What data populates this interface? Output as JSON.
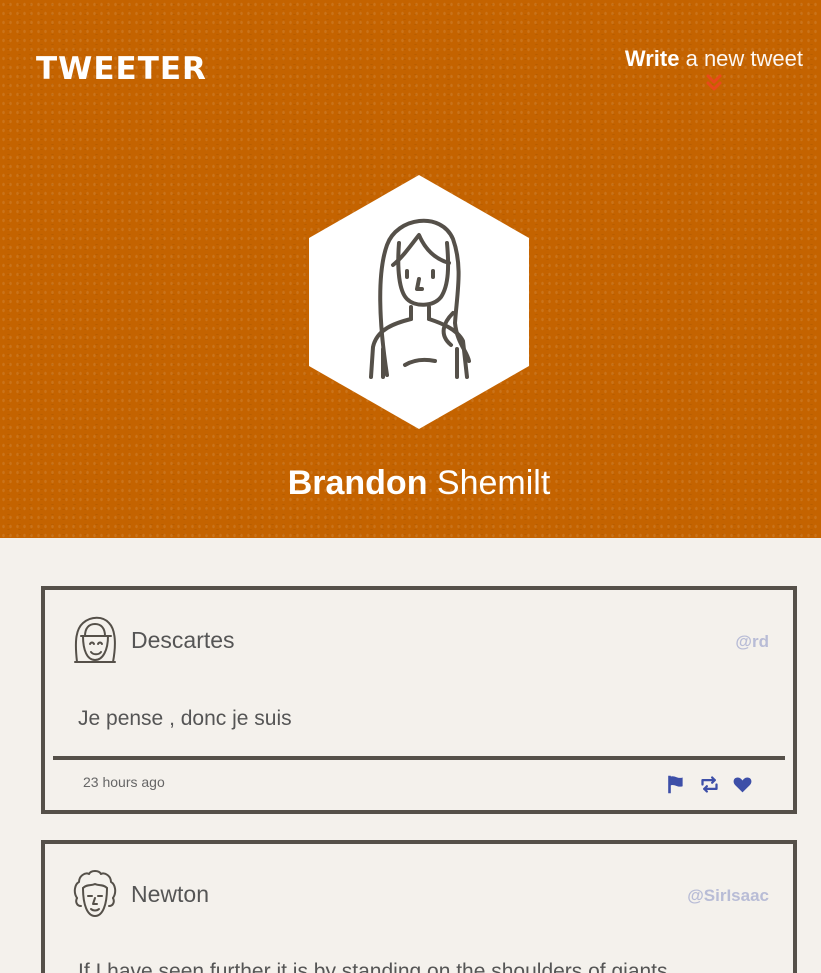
{
  "header": {
    "logo": "TWEETER",
    "compose_bold": "Write",
    "compose_light": " a new tweet"
  },
  "profile": {
    "first_name": "Brandon",
    "last_name": " Shemilt"
  },
  "tweets": [
    {
      "name": "Descartes",
      "handle": "@rd",
      "text": "Je pense , donc je suis",
      "time": "23 hours ago"
    },
    {
      "name": "Newton",
      "handle": "@SirIsaac",
      "text": "If I have seen further it is by standing on the shoulders of giants"
    }
  ],
  "colors": {
    "hero": "#c46300",
    "accent_arrow": "#e84a1a",
    "icon": "#3d4fa8",
    "handle": "#b8bcd6",
    "border": "#555049"
  },
  "icons": [
    "flag-icon",
    "retweet-icon",
    "heart-icon",
    "chevron-down-icon"
  ]
}
